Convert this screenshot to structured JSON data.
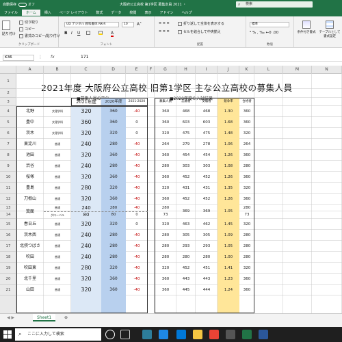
{
  "titlebar": {
    "autosave": "自動保存",
    "autosave_state": "オフ",
    "doc_title": "大阪府公立高校 第1学区 募集定員 2021 ・",
    "search": "検索"
  },
  "tabs": [
    "ファイル",
    "ホーム",
    "挿入",
    "ページ レイアウト",
    "数式",
    "データ",
    "校閲",
    "表示",
    "アドイン",
    "ヘルプ"
  ],
  "active_tab": "ホーム",
  "ribbon": {
    "paste": "貼り付け",
    "cut": "切り取り",
    "copy": "コピー",
    "format_painter": "書式のコピー/貼り付け",
    "clipboard": "クリップボード",
    "font_name": "UD デジタル 教科書体 NK-R",
    "font_size": "10",
    "font": "フォント",
    "wrap": "折り返して全体を表示する",
    "merge": "セルを結合して中央揃え",
    "alignment": "配置",
    "number_format": "標準",
    "number": "数値",
    "conditional": "条件付き書式",
    "table": "テーブルとして書式設定"
  },
  "formula": {
    "name_box": "K36",
    "fx": "fx",
    "value": "171"
  },
  "columns": [
    "A",
    "B",
    "C",
    "D",
    "E",
    "F",
    "G",
    "H",
    "I",
    "J",
    "K",
    "L",
    "M",
    "N"
  ],
  "rows": [
    "1",
    "2",
    "3",
    "4",
    "5",
    "6",
    "7",
    "8",
    "9",
    "10",
    "11",
    "12",
    "13",
    "14",
    "15",
    "16",
    "17",
    "18",
    "19",
    "20",
    "21"
  ],
  "sheet": {
    "title": "2021年度 大阪府公立高校 旧第1学区 主な公立高校の募集人員",
    "left_section": "■募集人員の変化",
    "right_section": "■2020年度の入試結果",
    "left_headers": [
      "2021年度",
      "2020年度",
      "2021-2020"
    ],
    "right_headers": [
      "募集人員",
      "志願者",
      "受験者",
      "競争率",
      "合格者"
    ],
    "schools": [
      {
        "name": "北野",
        "course": "文理学科",
        "y2021": "320",
        "y2020": "360",
        "diff": "-40",
        "r": [
          "360",
          "468",
          "468",
          "1.30",
          "360"
        ]
      },
      {
        "name": "豊中",
        "course": "文理学科",
        "y2021": "360",
        "y2020": "360",
        "diff": "0",
        "r": [
          "360",
          "603",
          "603",
          "1.68",
          "360"
        ]
      },
      {
        "name": "茨木",
        "course": "文理学科",
        "y2021": "320",
        "y2020": "320",
        "diff": "0",
        "r": [
          "320",
          "475",
          "475",
          "1.48",
          "320"
        ]
      },
      {
        "name": "東淀川",
        "course": "普通",
        "y2021": "240",
        "y2020": "280",
        "diff": "-40",
        "r": [
          "264",
          "279",
          "278",
          "1.06",
          "264"
        ]
      },
      {
        "name": "池田",
        "course": "普通",
        "y2021": "320",
        "y2020": "360",
        "diff": "-40",
        "r": [
          "360",
          "454",
          "454",
          "1.26",
          "360"
        ]
      },
      {
        "name": "渋谷",
        "course": "普通",
        "y2021": "240",
        "y2020": "280",
        "diff": "-40",
        "r": [
          "280",
          "303",
          "303",
          "1.08",
          "280"
        ]
      },
      {
        "name": "桜塚",
        "course": "普通",
        "y2021": "320",
        "y2020": "360",
        "diff": "-40",
        "r": [
          "360",
          "452",
          "452",
          "1.26",
          "360"
        ]
      },
      {
        "name": "豊島",
        "course": "普通",
        "y2021": "280",
        "y2020": "320",
        "diff": "-40",
        "r": [
          "320",
          "431",
          "431",
          "1.35",
          "320"
        ]
      },
      {
        "name": "刀根山",
        "course": "普通",
        "y2021": "320",
        "y2020": "360",
        "diff": "-40",
        "r": [
          "360",
          "452",
          "452",
          "1.26",
          "360"
        ]
      }
    ],
    "minoo": {
      "name": "箕面",
      "row1": {
        "course": "普通",
        "y2021": "240",
        "y2020": "280",
        "diff": "-40",
        "r_quota": "280"
      },
      "row2": {
        "course": "グローバル",
        "y2021": "80",
        "y2020": "80",
        "diff": "0",
        "r_quota": "73"
      },
      "merged": [
        "369",
        "369",
        "1.05"
      ],
      "r_pass1": "280",
      "r_pass2": "73"
    },
    "schools2": [
      {
        "name": "春日丘",
        "course": "普通",
        "y2021": "320",
        "y2020": "320",
        "diff": "0",
        "r": [
          "320",
          "463",
          "462",
          "1.45",
          "320"
        ]
      },
      {
        "name": "茨木西",
        "course": "普通",
        "y2021": "240",
        "y2020": "280",
        "diff": "-40",
        "r": [
          "280",
          "305",
          "305",
          "1.09",
          "280"
        ]
      },
      {
        "name": "北摂つばさ",
        "course": "普通",
        "y2021": "240",
        "y2020": "280",
        "diff": "-40",
        "r": [
          "280",
          "293",
          "293",
          "1.05",
          "280"
        ]
      },
      {
        "name": "吹田",
        "course": "普通",
        "y2021": "240",
        "y2020": "280",
        "diff": "-40",
        "r": [
          "280",
          "280",
          "280",
          "1.00",
          "280"
        ]
      },
      {
        "name": "吹田東",
        "course": "普通",
        "y2021": "280",
        "y2020": "320",
        "diff": "-40",
        "r": [
          "320",
          "452",
          "451",
          "1.41",
          "320"
        ]
      },
      {
        "name": "北千里",
        "course": "普通",
        "y2021": "320",
        "y2020": "360",
        "diff": "-40",
        "r": [
          "360",
          "443",
          "443",
          "1.23",
          "360"
        ]
      },
      {
        "name": "山田",
        "course": "普通",
        "y2021": "320",
        "y2020": "360",
        "diff": "-40",
        "r": [
          "360",
          "445",
          "444",
          "1.24",
          "360"
        ]
      }
    ]
  },
  "sheet_tab": "Sheet1",
  "colors": {
    "excel_green": "#217346",
    "blue_col": "#c5d9f1",
    "blue_col_dark": "#b8d0ee",
    "yellow_col": "#ffe699",
    "neg_red": "#c00000"
  },
  "taskbar": {
    "search": "ここに入力して検索"
  }
}
